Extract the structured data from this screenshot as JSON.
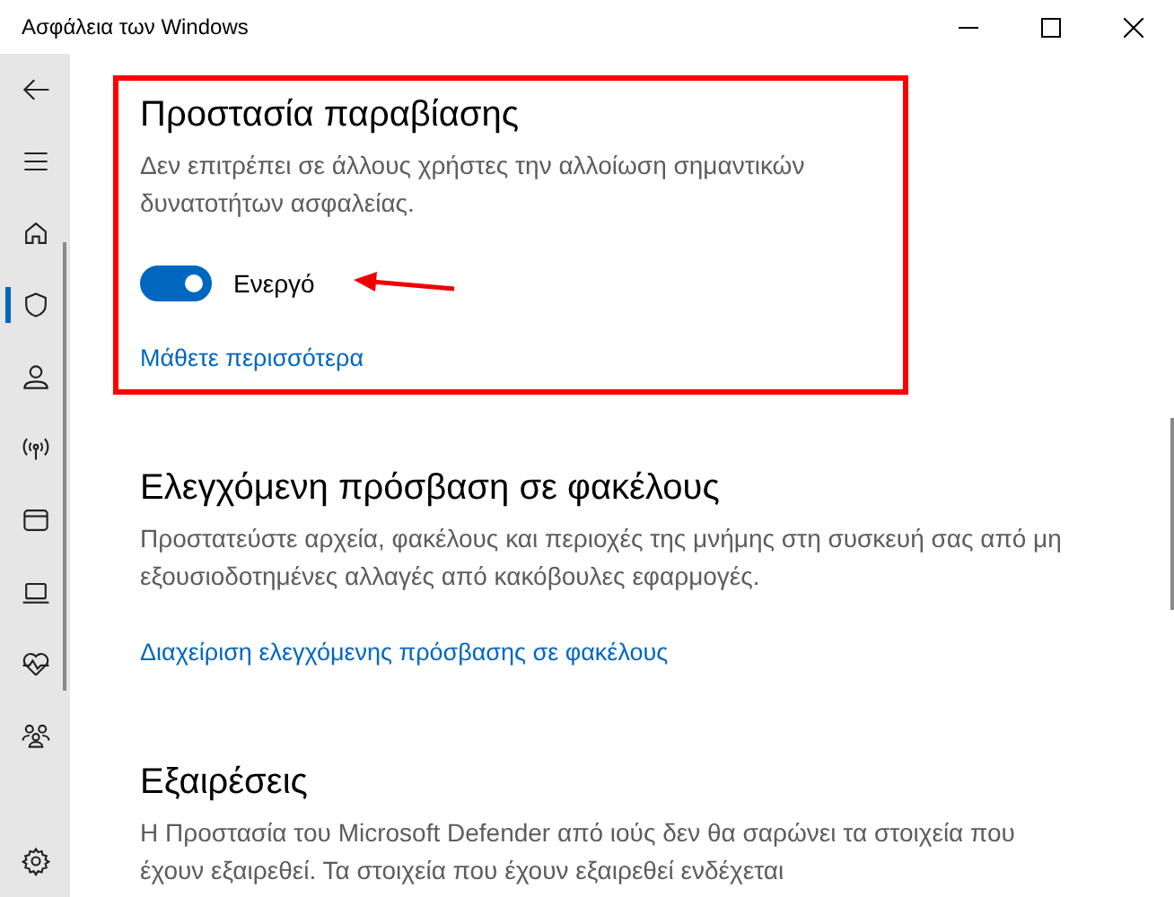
{
  "window": {
    "title": "Ασφάλεια των Windows"
  },
  "sidebar": {
    "items": [
      {
        "kind": "back",
        "selected": false
      },
      {
        "kind": "menu",
        "selected": false
      },
      {
        "kind": "home",
        "selected": false
      },
      {
        "kind": "shield",
        "selected": true
      },
      {
        "kind": "person",
        "selected": false
      },
      {
        "kind": "wireless",
        "selected": false
      },
      {
        "kind": "browser",
        "selected": false
      },
      {
        "kind": "laptop",
        "selected": false
      },
      {
        "kind": "health",
        "selected": false
      },
      {
        "kind": "family",
        "selected": false
      },
      {
        "kind": "settings",
        "selected": false
      }
    ]
  },
  "sections": [
    {
      "title": "Προστασία παραβίασης",
      "description": "Δεν επιτρέπει σε άλλους χρήστες την αλλοίωση σημαντικών δυνατοτήτων ασφαλείας.",
      "highlighted": true,
      "toggle": {
        "on": true,
        "label": "Ενεργό"
      },
      "link": "Μάθετε περισσότερα"
    },
    {
      "title": "Ελεγχόμενη πρόσβαση σε φακέλους",
      "description": "Προστατεύστε αρχεία, φακέλους και περιοχές της μνήμης στη συσκευή σας από μη εξουσιοδοτημένες αλλαγές από κακόβουλες εφαρμογές.",
      "highlighted": false,
      "link": "Διαχείριση ελεγχόμενης πρόσβασης σε φακέλους"
    },
    {
      "title": "Εξαιρέσεις",
      "description": "Η Προστασία του Microsoft Defender από ιούς δεν θα σαρώνει τα στοιχεία που έχουν εξαιρεθεί. Τα στοιχεία που έχουν εξαιρεθεί ενδέχεται",
      "highlighted": false
    }
  ]
}
